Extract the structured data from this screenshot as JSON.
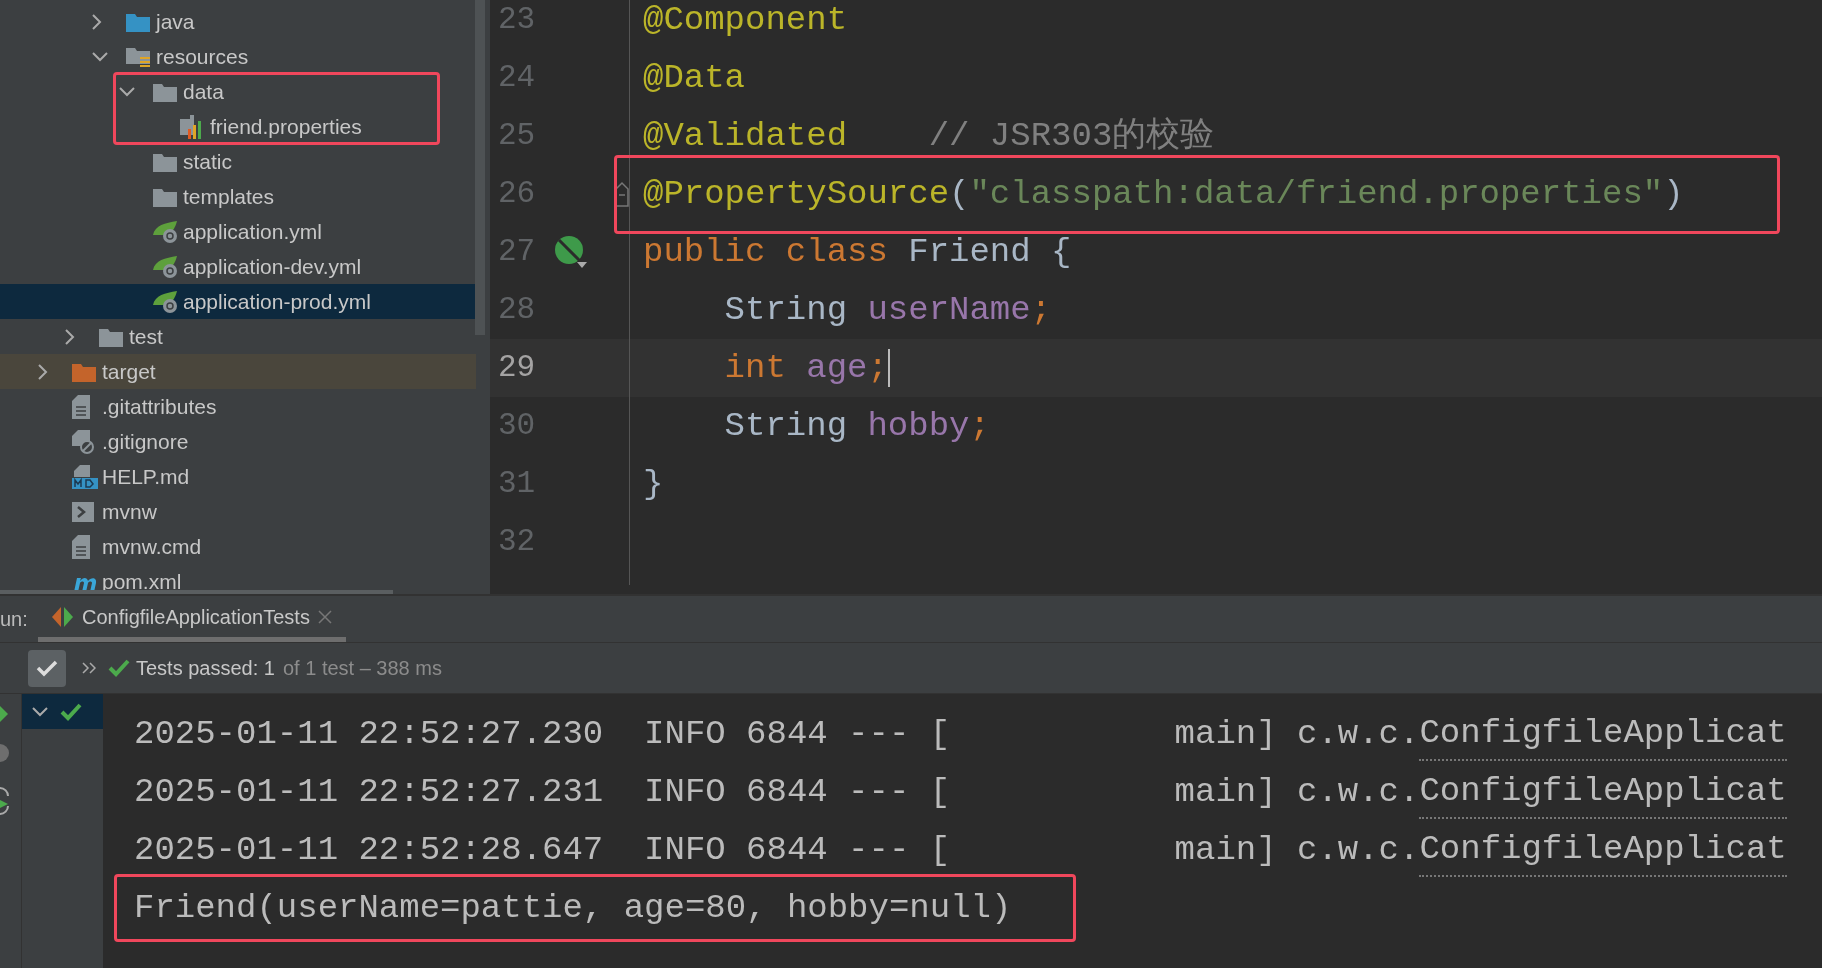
{
  "project_tree": {
    "items": [
      {
        "children": [
          {
            "children": [
              {
                "label": "java",
                "kind": "source-folder",
                "expanded": false,
                "selected": false
              },
              {
                "label": "resources",
                "kind": "resources-folder",
                "expanded": true,
                "selected": false,
                "children": [
                  {
                    "label": "data",
                    "kind": "folder",
                    "expanded": true,
                    "selected": false,
                    "highlighted": true,
                    "children": [
                      {
                        "label": "friend.properties",
                        "kind": "properties",
                        "selected": false
                      }
                    ]
                  },
                  {
                    "label": "static",
                    "kind": "folder",
                    "selected": false
                  },
                  {
                    "label": "templates",
                    "kind": "folder",
                    "selected": false
                  },
                  {
                    "label": "application.yml",
                    "kind": "spring-yml",
                    "selected": false
                  },
                  {
                    "label": "application-dev.yml",
                    "kind": "spring-yml",
                    "selected": false
                  },
                  {
                    "label": "application-prod.yml",
                    "kind": "spring-yml",
                    "selected": true
                  }
                ]
              }
            ]
          },
          {
            "label": "test",
            "kind": "folder",
            "expanded": false,
            "selected": false
          }
        ]
      },
      {
        "label": "target",
        "kind": "excluded-folder",
        "expanded": false,
        "selected": false
      },
      {
        "label": ".gitattributes",
        "kind": "text-file",
        "selected": false
      },
      {
        "label": ".gitignore",
        "kind": "ignore-file",
        "selected": false
      },
      {
        "label": "HELP.md",
        "kind": "markdown",
        "selected": false
      },
      {
        "label": "mvnw",
        "kind": "script",
        "selected": false
      },
      {
        "label": "mvnw.cmd",
        "kind": "text-file",
        "selected": false
      },
      {
        "label": "pom.xml",
        "kind": "pom",
        "selected": false
      }
    ]
  },
  "editor": {
    "lines": [
      {
        "number": "23",
        "current": false,
        "tokens": [
          {
            "kind": "annotation",
            "text": "@Component"
          }
        ]
      },
      {
        "number": "24",
        "current": false,
        "tokens": [
          {
            "kind": "annotation",
            "text": "@Data"
          }
        ]
      },
      {
        "number": "25",
        "current": false,
        "tokens": [
          {
            "kind": "annotation",
            "text": "@Validated"
          },
          {
            "kind": "comment",
            "text": "    // JSR303的校验"
          }
        ]
      },
      {
        "number": "26",
        "current": false,
        "gutter": {
          "kind": "fold"
        },
        "highlighted": true,
        "tokens": [
          {
            "kind": "annotation",
            "text": "@PropertySource"
          },
          {
            "kind": "plain",
            "text": "("
          },
          {
            "kind": "string",
            "text": "\"classpath:data/friend.properties\""
          },
          {
            "kind": "plain",
            "text": ")"
          }
        ]
      },
      {
        "number": "27",
        "current": false,
        "gutter": {
          "kind": "bean"
        },
        "tokens": [
          {
            "kind": "keyword",
            "text": "public class"
          },
          {
            "kind": "plain",
            "text": " Friend {"
          }
        ]
      },
      {
        "number": "28",
        "current": false,
        "tokens": [
          {
            "kind": "plain",
            "text": "    String "
          },
          {
            "kind": "field",
            "text": "userName"
          },
          {
            "kind": "keyword",
            "text": ";"
          }
        ]
      },
      {
        "number": "29",
        "current": true,
        "caret": true,
        "tokens": [
          {
            "kind": "keyword",
            "text": "    int"
          },
          {
            "kind": "field",
            "text": " age"
          },
          {
            "kind": "keyword",
            "text": ";"
          }
        ]
      },
      {
        "number": "30",
        "current": false,
        "tokens": [
          {
            "kind": "plain",
            "text": "    String "
          },
          {
            "kind": "field",
            "text": "hobby"
          },
          {
            "kind": "keyword",
            "text": ";"
          }
        ]
      },
      {
        "number": "31",
        "current": false,
        "tokens": [
          {
            "kind": "plain",
            "text": "}"
          }
        ]
      },
      {
        "number": "32",
        "current": false
      }
    ]
  },
  "run_panel": {
    "prefix": "un:",
    "tabs": [
      {
        "label": "ConfigfileApplicationTests",
        "selected": true
      }
    ],
    "status": {
      "passed": "Tests passed: 1",
      "detail": "of 1 test – 388 ms"
    },
    "console": [
      {
        "text": "2025-01-11 22:52:27.230  INFO 6844 --- [           main] c.w.c.",
        "link": "ConfigfileApplicat",
        "highlighted": false
      },
      {
        "text": "2025-01-11 22:52:27.231  INFO 6844 --- [           main] c.w.c.",
        "link": "ConfigfileApplicat",
        "highlighted": false
      },
      {
        "text": "2025-01-11 22:52:28.647  INFO 6844 --- [           main] c.w.c.",
        "link": "ConfigfileApplicat",
        "highlighted": false
      },
      {
        "text": "Friend(userName=pattie, age=80, hobby=null)",
        "highlighted": true
      }
    ]
  }
}
